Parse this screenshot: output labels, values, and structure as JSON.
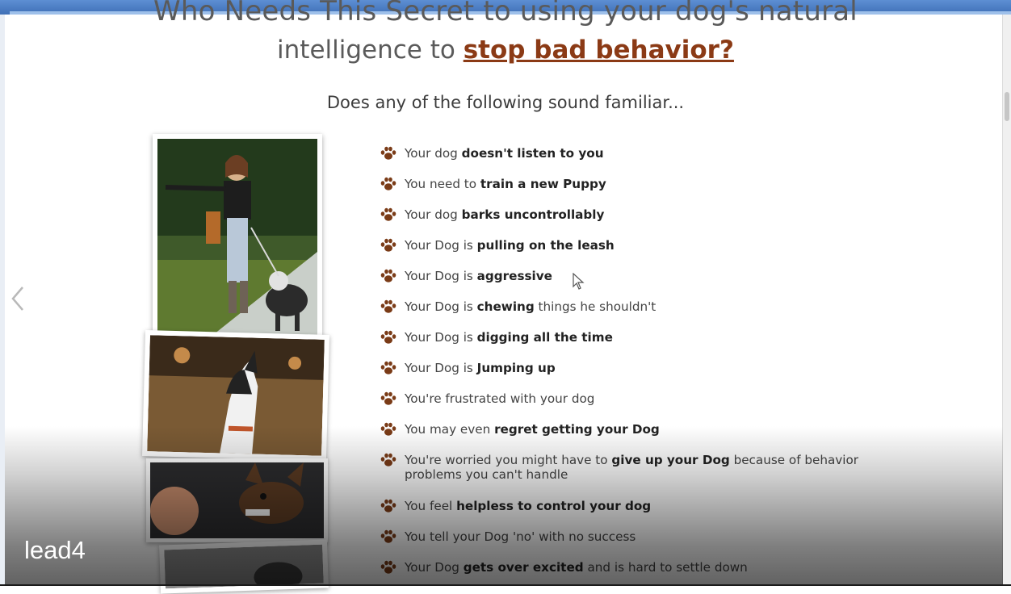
{
  "page": {
    "headline_cut": "Who Needs This Secret to using your dog's natural",
    "headline_text": "intelligence to ",
    "headline_accent": "stop bad behavior?",
    "subhead": "Does any of the following sound familiar..."
  },
  "list_items": [
    {
      "pre": "Your dog ",
      "bold": "doesn't listen to you",
      "post": ""
    },
    {
      "pre": "You need to ",
      "bold": "train a new Puppy",
      "post": ""
    },
    {
      "pre": "Your dog ",
      "bold": "barks uncontrollably",
      "post": ""
    },
    {
      "pre": "Your Dog is ",
      "bold": "pulling on the leash",
      "post": ""
    },
    {
      "pre": "Your Dog is ",
      "bold": "aggressive",
      "post": ""
    },
    {
      "pre": "Your Dog is ",
      "bold": "chewing",
      "post": " things he shouldn't"
    },
    {
      "pre": "Your Dog is ",
      "bold": "digging all the time",
      "post": ""
    },
    {
      "pre": "Your Dog is ",
      "bold": "Jumping up",
      "post": ""
    },
    {
      "pre": "You're frustrated with your dog",
      "bold": "",
      "post": ""
    },
    {
      "pre": "You may even ",
      "bold": "regret getting your Dog",
      "post": ""
    },
    {
      "pre": "You're worried you might have to ",
      "bold": "give up your Dog",
      "post": " because of behavior problems you can't handle"
    },
    {
      "pre": "You feel ",
      "bold": "helpless to control your dog",
      "post": ""
    },
    {
      "pre": "You tell your Dog 'no' with no success",
      "bold": "",
      "post": ""
    },
    {
      "pre": "Your Dog ",
      "bold": "gets over excited",
      "post": " and is hard to settle down"
    }
  ],
  "icons": {
    "bullet": "paw-icon",
    "nav": "chevron-left-icon",
    "pointer": "mouse-cursor-icon"
  },
  "overlay": {
    "label": "lead4"
  },
  "colors": {
    "accent": "#8b3a15",
    "paw": "#7a3b17",
    "window_frame": "#3f6fb6"
  }
}
